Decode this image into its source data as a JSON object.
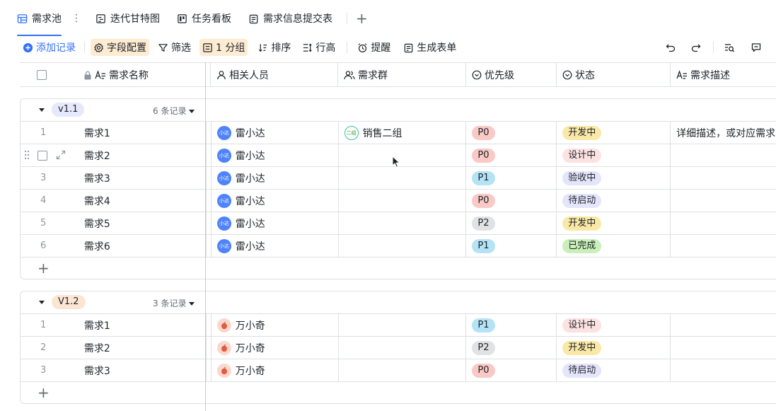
{
  "tabs": [
    {
      "label": "需求池",
      "icon": "grid-table-icon",
      "active": true
    },
    {
      "label": "迭代甘特图",
      "icon": "gantt-icon"
    },
    {
      "label": "任务看板",
      "icon": "kanban-icon"
    },
    {
      "label": "需求信息提交表",
      "icon": "form-icon"
    }
  ],
  "toolbar": {
    "add_record": "添加记录",
    "field_config": "字段配置",
    "filter": "筛选",
    "group": "1 分组",
    "sort": "排序",
    "row_height": "行高",
    "reminder": "提醒",
    "generate_form": "生成表单"
  },
  "columns": {
    "name": "需求名称",
    "person": "相关人员",
    "group": "需求群",
    "priority": "优先级",
    "status": "状态",
    "desc": "需求描述"
  },
  "colors": {
    "accent": "#3370ff",
    "p0": "#f9c9c5",
    "p1": "#b5e3f6",
    "p2": "#e1e2e4",
    "dev": "#fae9a6",
    "design": "#fde2e2",
    "accept": "#e4e5fb",
    "pending": "#e4e5fb",
    "done": "#c8f0b8"
  },
  "groups": [
    {
      "tag": "v1.1",
      "tag_color": "#e6e8fb",
      "count": "6 条记录",
      "rows": [
        {
          "idx": "1",
          "name": "需求1",
          "person": "雷小达",
          "avatar": "小达",
          "group": "销售二组",
          "group_avatar": "二组",
          "priority": "P0",
          "status": "开发中",
          "desc": "详细描述，或对应需求"
        },
        {
          "idx": "2",
          "name": "需求2",
          "person": "雷小达",
          "avatar": "小达",
          "group": "",
          "group_avatar": "",
          "priority": "P0",
          "status": "设计中",
          "desc": "",
          "hover": true
        },
        {
          "idx": "3",
          "name": "需求3",
          "person": "雷小达",
          "avatar": "小达",
          "group": "",
          "group_avatar": "",
          "priority": "P1",
          "status": "验收中",
          "desc": ""
        },
        {
          "idx": "4",
          "name": "需求4",
          "person": "雷小达",
          "avatar": "小达",
          "group": "",
          "group_avatar": "",
          "priority": "P0",
          "status": "待启动",
          "desc": ""
        },
        {
          "idx": "5",
          "name": "需求5",
          "person": "雷小达",
          "avatar": "小达",
          "group": "",
          "group_avatar": "",
          "priority": "P2",
          "status": "开发中",
          "desc": ""
        },
        {
          "idx": "6",
          "name": "需求6",
          "person": "雷小达",
          "avatar": "小达",
          "group": "",
          "group_avatar": "",
          "priority": "P1",
          "status": "已完成",
          "desc": ""
        }
      ]
    },
    {
      "tag": "V1.2",
      "tag_color": "#fde5d3",
      "count": "3 条记录",
      "rows": [
        {
          "idx": "1",
          "name": "需求1",
          "person": "万小奇",
          "avatar": "",
          "group": "",
          "group_avatar": "",
          "priority": "P1",
          "status": "设计中",
          "desc": ""
        },
        {
          "idx": "2",
          "name": "需求2",
          "person": "万小奇",
          "avatar": "",
          "group": "",
          "group_avatar": "",
          "priority": "P2",
          "status": "开发中",
          "desc": ""
        },
        {
          "idx": "3",
          "name": "需求3",
          "person": "万小奇",
          "avatar": "",
          "group": "",
          "group_avatar": "",
          "priority": "P0",
          "status": "待启动",
          "desc": ""
        }
      ]
    }
  ]
}
